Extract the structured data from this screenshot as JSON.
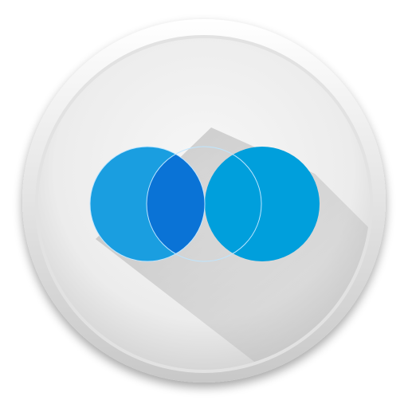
{
  "app_icon": {
    "icon_name": "venn-diagram-icon",
    "colors": {
      "plate_light": "#f7f7f7",
      "plate_mid": "#ececec",
      "plate_edge": "#d6d6d6",
      "rim_shadow": "#c9c9c9",
      "circle_left": "#1a9ee0",
      "circle_right": "#009fdc",
      "overlap": "#0a73d6",
      "circle_outline": "#bfe6ff"
    }
  }
}
